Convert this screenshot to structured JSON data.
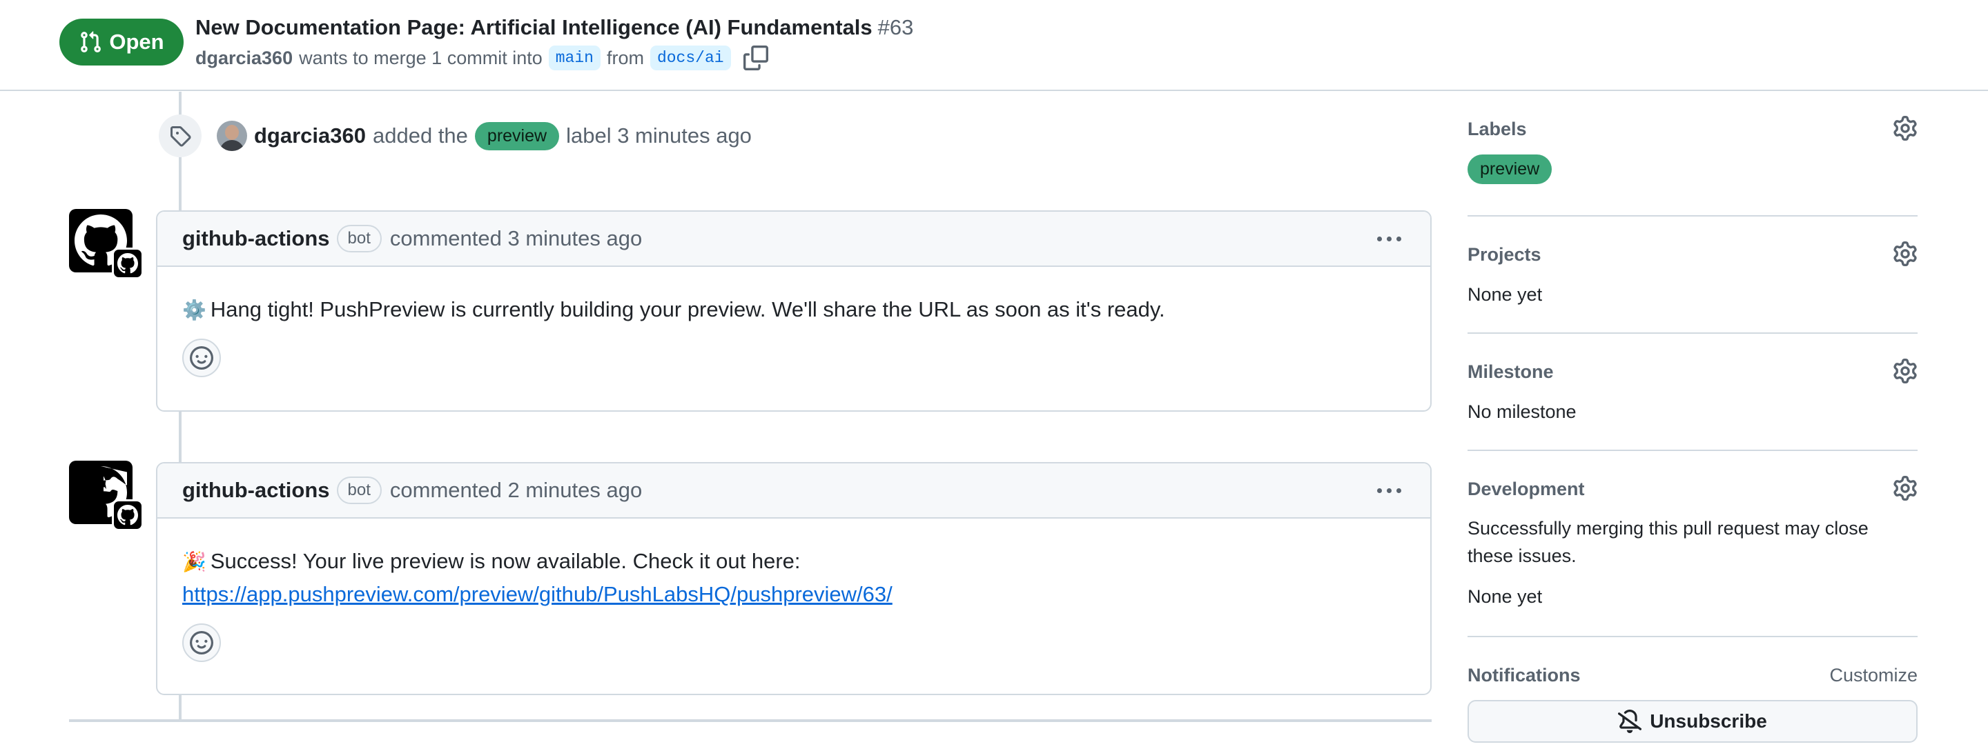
{
  "header": {
    "state": "Open",
    "title": "New Documentation Page: Artificial Intelligence (AI) Fundamentals",
    "number": "#63",
    "author": "dgarcia360",
    "merge_text": "wants to merge 1 commit into",
    "base_branch": "main",
    "from_text": "from",
    "head_branch": "docs/ai"
  },
  "timeline": {
    "label_event": {
      "actor": "dgarcia360",
      "action": "added the",
      "label": "preview",
      "suffix": "label 3 minutes ago"
    },
    "comments": [
      {
        "author": "github-actions",
        "badge": "bot",
        "meta": "commented 3 minutes ago",
        "emoji": "⚙️",
        "body": "Hang tight! PushPreview is currently building your preview. We'll share the URL as soon as it's ready."
      },
      {
        "author": "github-actions",
        "badge": "bot",
        "meta": "commented 2 minutes ago",
        "emoji": "🎉",
        "body": "Success! Your live preview is now available. Check it out here:",
        "link": "https://app.pushpreview.com/preview/github/PushLabsHQ/pushpreview/63/"
      }
    ]
  },
  "sidebar": {
    "labels": {
      "heading": "Labels",
      "items": [
        "preview"
      ]
    },
    "projects": {
      "heading": "Projects",
      "value": "None yet"
    },
    "milestone": {
      "heading": "Milestone",
      "value": "No milestone"
    },
    "development": {
      "heading": "Development",
      "description": "Successfully merging this pull request may close these issues.",
      "value": "None yet"
    },
    "notifications": {
      "heading": "Notifications",
      "customize": "Customize",
      "button": "Unsubscribe"
    }
  },
  "colors": {
    "open_green": "#1f883d",
    "label_preview": "#3fa97c",
    "link_blue": "#0969da",
    "border": "#d1d9e0"
  },
  "icons": [
    "git-pull-request-icon",
    "copy-icon",
    "tag-icon",
    "github-mark-icon",
    "kebab-icon",
    "smiley-icon",
    "gear-icon",
    "bell-slash-icon"
  ]
}
